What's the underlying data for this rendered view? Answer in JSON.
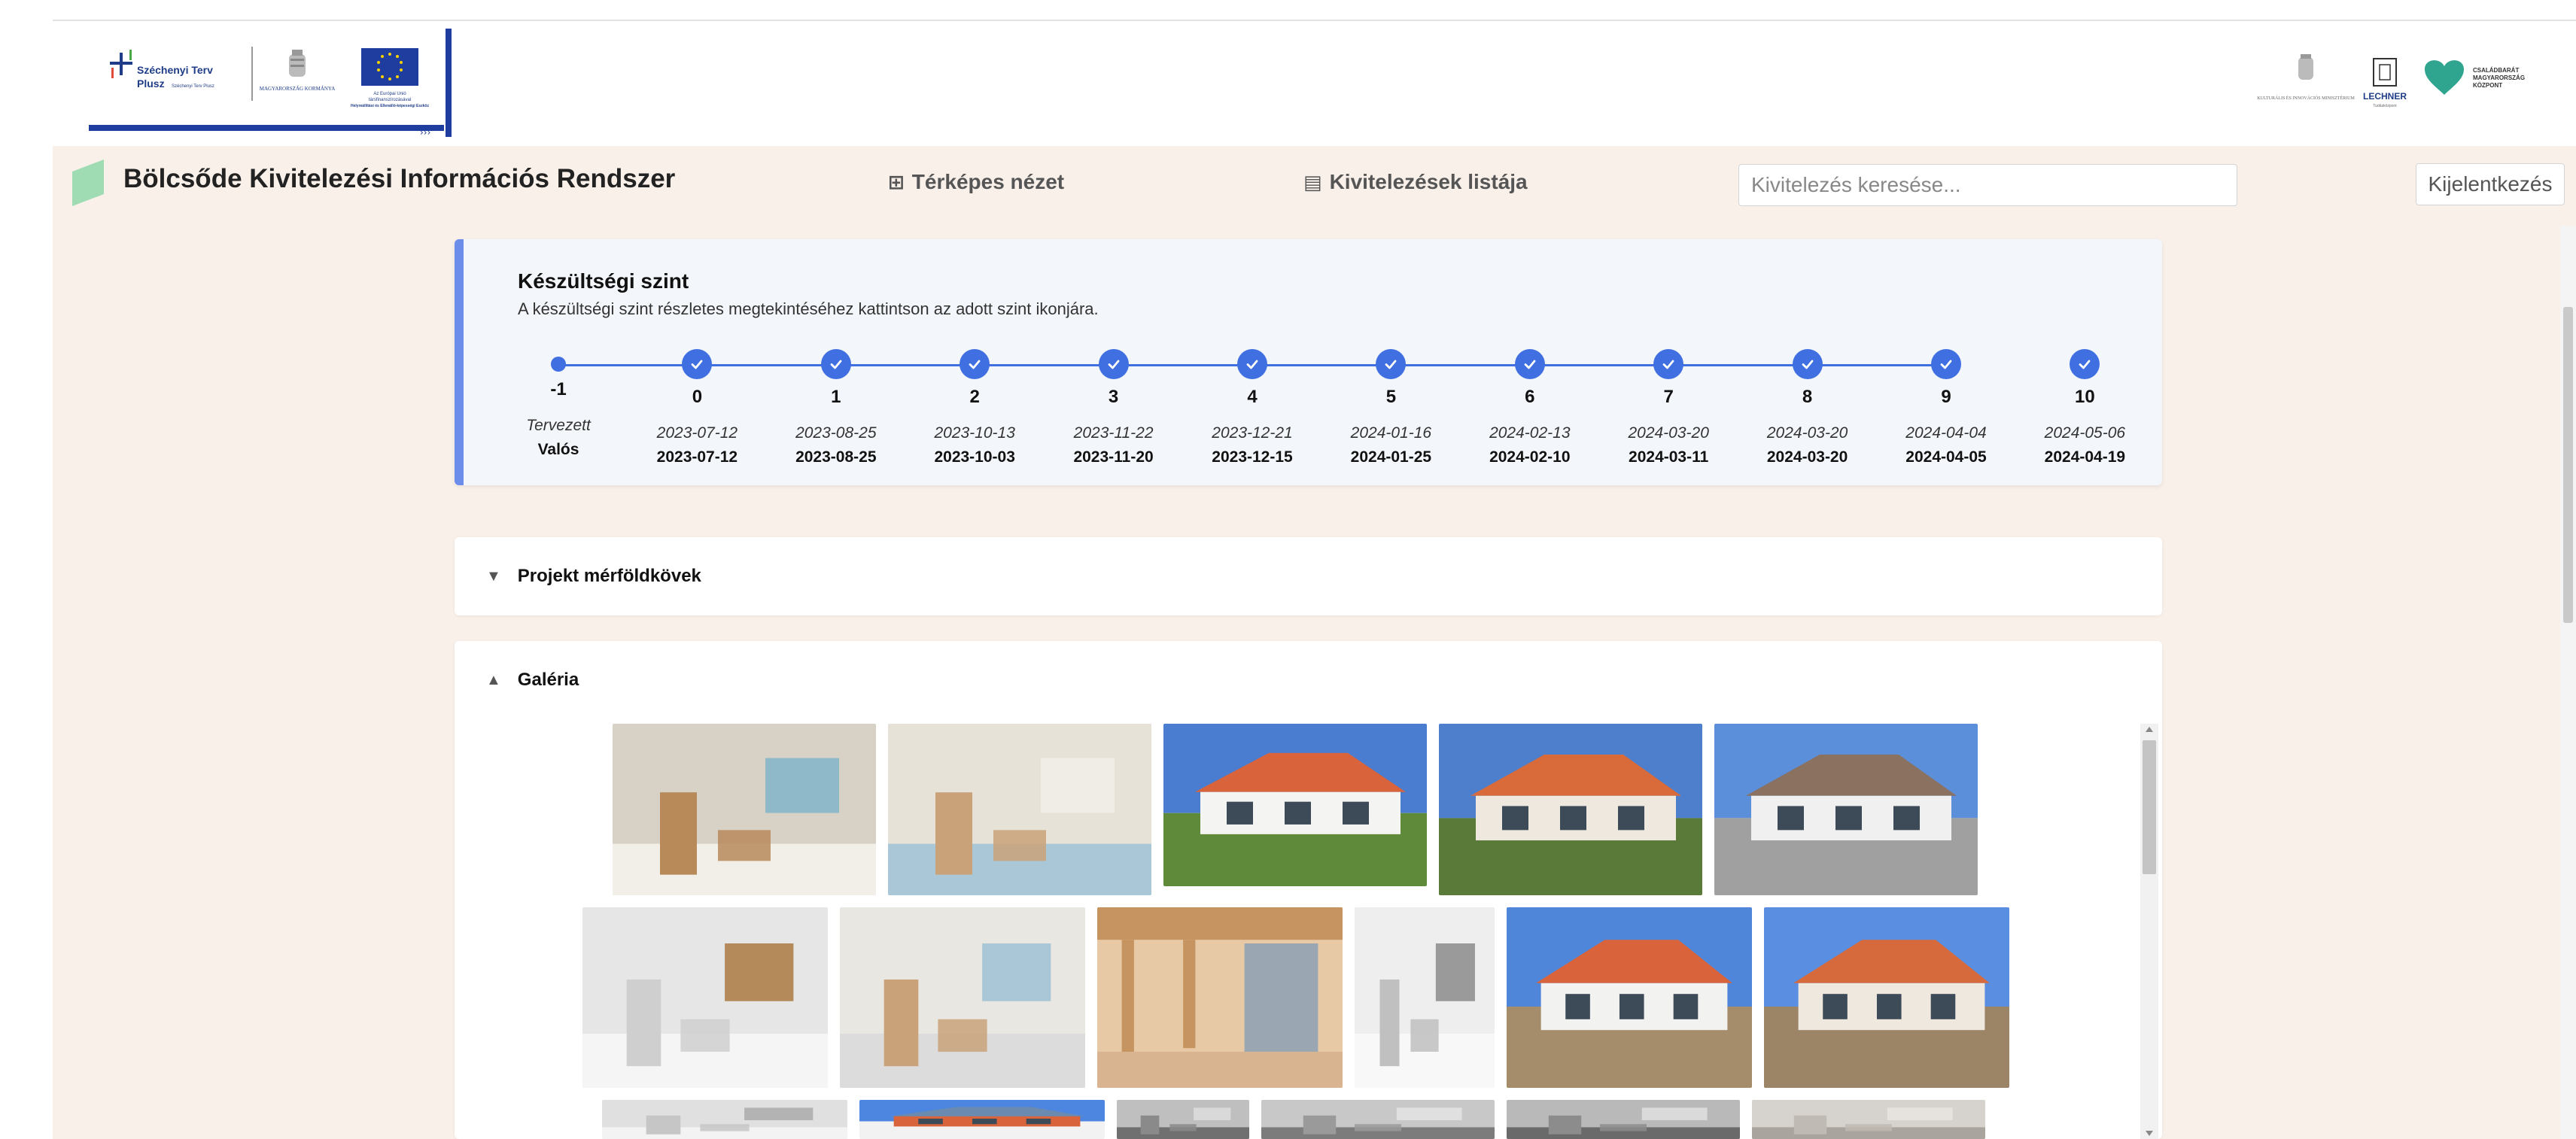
{
  "header": {
    "app_title": "Bölcsőde Kivitelezési Információs Rendszer",
    "nav_map_label": "Térképes nézet",
    "nav_map_icon": "map-grid-icon",
    "nav_list_label": "Kivitelezések listája",
    "nav_list_icon": "list-window-icon",
    "search_placeholder": "Kivitelezés keresése...",
    "logout_label": "Kijelentkezés",
    "brand_color": "#8fd3a8"
  },
  "logos_left": {
    "szechenyi_line1": "Széchenyi Terv",
    "szechenyi_line2": "Plusz",
    "szechenyi_small": "Széchenyi Terv Plusz",
    "ministry": "MAGYARORSZÁG KORMÁNYA",
    "eu_line1": "Az Európai Unió",
    "eu_line2": "társfinanszírozásával",
    "eu_line3": "Helyreállítási és Ellenálló-képességi Eszköz"
  },
  "logos_right": {
    "ministry": "KULTURÁLIS ÉS INNOVÁCIÓS MINISZTÉRIUM",
    "lechner": "LECHNER",
    "lechner_sub": "Tudásközpont",
    "family_line1": "CSALÁDBARÁT",
    "family_line2": "MAGYARORSZÁG",
    "family_line3": "KÖZPONT"
  },
  "progress": {
    "title": "Készültségi szint",
    "subtitle": "A készültségi szint részletes megtekintéséhez kattintson az adott szint ikonjára.",
    "accent_color": "#3f6fe0",
    "steps": [
      {
        "num": "-1",
        "planned": "Tervezett",
        "actual": "Valós",
        "completed": false
      },
      {
        "num": "0",
        "planned": "2023-07-12",
        "actual": "2023-07-12",
        "completed": true
      },
      {
        "num": "1",
        "planned": "2023-08-25",
        "actual": "2023-08-25",
        "completed": true
      },
      {
        "num": "2",
        "planned": "2023-10-13",
        "actual": "2023-10-03",
        "completed": true
      },
      {
        "num": "3",
        "planned": "2023-11-22",
        "actual": "2023-11-20",
        "completed": true
      },
      {
        "num": "4",
        "planned": "2023-12-21",
        "actual": "2023-12-15",
        "completed": true
      },
      {
        "num": "5",
        "planned": "2024-01-16",
        "actual": "2024-01-25",
        "completed": true
      },
      {
        "num": "6",
        "planned": "2024-02-13",
        "actual": "2024-02-10",
        "completed": true
      },
      {
        "num": "7",
        "planned": "2024-03-20",
        "actual": "2024-03-11",
        "completed": true
      },
      {
        "num": "8",
        "planned": "2024-03-20",
        "actual": "2024-03-20",
        "completed": true
      },
      {
        "num": "9",
        "planned": "2024-04-04",
        "actual": "2024-04-05",
        "completed": true
      },
      {
        "num": "10",
        "planned": "2024-05-06",
        "actual": "2024-04-19",
        "completed": true
      }
    ]
  },
  "milestones": {
    "label": "Projekt mérföldkövek",
    "toggle_icon": "triangle-down-icon"
  },
  "gallery": {
    "label": "Galéria",
    "toggle_icon": "triangle-up-icon",
    "photos": [
      {
        "subject": "interior-playroom"
      },
      {
        "subject": "interior-classroom"
      },
      {
        "subject": "exterior-building"
      },
      {
        "subject": "exterior-fence"
      },
      {
        "subject": "exterior-facade"
      },
      {
        "subject": "interior-empty-room"
      },
      {
        "subject": "interior-construction"
      },
      {
        "subject": "terrace-pergola"
      },
      {
        "subject": "interior-corridor"
      },
      {
        "subject": "exterior-construction"
      },
      {
        "subject": "exterior-construction-2"
      },
      {
        "subject": "interior-room"
      },
      {
        "subject": "exterior-roof"
      },
      {
        "subject": "interior-ceiling"
      },
      {
        "subject": "interior-ceiling-2"
      },
      {
        "subject": "interior-ceiling-3"
      },
      {
        "subject": "interior-wall"
      }
    ]
  }
}
